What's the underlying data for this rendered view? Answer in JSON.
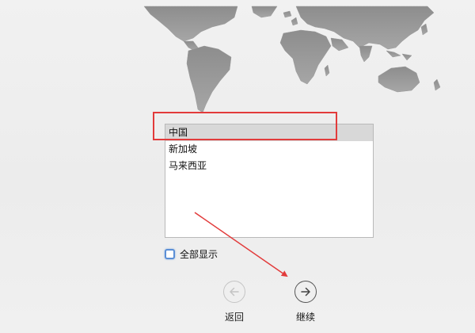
{
  "region_list": {
    "items": [
      {
        "label": "中国",
        "selected": true
      },
      {
        "label": "新加坡",
        "selected": false
      },
      {
        "label": "马来西亚",
        "selected": false
      }
    ]
  },
  "show_all": {
    "label": "全部显示",
    "checked": false
  },
  "nav": {
    "back_label": "返回",
    "continue_label": "继续"
  },
  "icons": {
    "back": "arrow-left-circle-icon",
    "continue": "arrow-right-circle-icon"
  },
  "colors": {
    "annotation_red": "#e23b3b",
    "selection_gray": "#d8d8d8",
    "checkbox_focus_blue": "#5b8fd6"
  }
}
